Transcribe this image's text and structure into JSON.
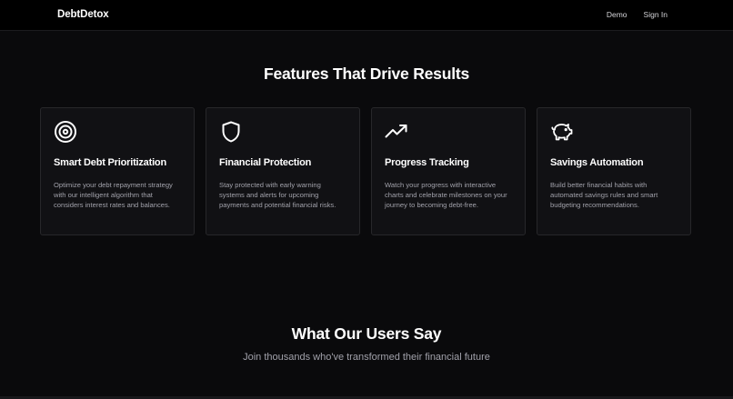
{
  "nav": {
    "brand": "DebtDetox",
    "links": [
      "Demo",
      "Sign In"
    ]
  },
  "features": {
    "title": "Features That Drive Results",
    "cards": [
      {
        "icon": "target-icon",
        "title": "Smart Debt Prioritization",
        "description": "Optimize your debt repayment strategy with our intelligent algorithm that considers interest rates and balances."
      },
      {
        "icon": "shield-icon",
        "title": "Financial Protection",
        "description": "Stay protected with early warning systems and alerts for upcoming payments and potential financial risks."
      },
      {
        "icon": "trending-up-icon",
        "title": "Progress Tracking",
        "description": "Watch your progress with interactive charts and celebrate milestones on your journey to becoming debt-free."
      },
      {
        "icon": "piggy-bank-icon",
        "title": "Savings Automation",
        "description": "Build better financial habits with automated savings rules and smart budgeting recommendations."
      }
    ]
  },
  "testimonials": {
    "title": "What Our Users Say",
    "subtitle": "Join thousands who've transformed their financial future"
  },
  "colors": {
    "background": "#0a0a0c",
    "navbar": "#000000",
    "card": "#111114",
    "card_border": "#27272a",
    "text_primary": "#ffffff",
    "text_muted": "#a1a1aa"
  }
}
